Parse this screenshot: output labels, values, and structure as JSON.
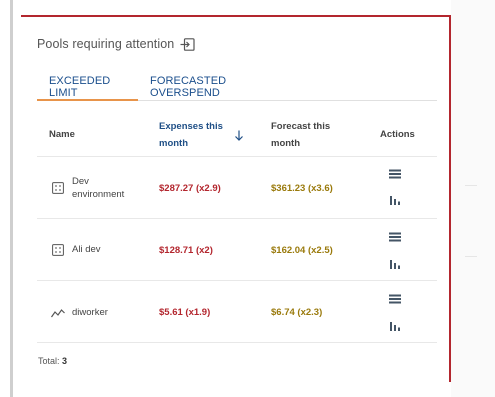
{
  "widget": {
    "title": "Pools requiring attention",
    "title_icon": "open-link-icon",
    "accent_color": "#b3262e",
    "tab_indicator_color": "#e8944a"
  },
  "tabs": [
    {
      "label": "EXCEEDED LIMIT",
      "active": true
    },
    {
      "label": "FORECASTED OVERSPEND",
      "active": false
    }
  ],
  "table": {
    "headers": {
      "name": "Name",
      "expenses_line1": "Expenses this",
      "expenses_line2": "month",
      "forecast_line1": "Forecast this",
      "forecast_line2": "month",
      "actions": "Actions"
    },
    "sort": {
      "column": "expenses",
      "direction": "descending",
      "icon": "arrow-down-icon"
    },
    "rows": [
      {
        "icon": "pool-grid-icon",
        "name_line1": "Dev",
        "name_line2": "environment",
        "expenses": "$287.27 (x2.9)",
        "forecast": "$361.23 (x3.6)"
      },
      {
        "icon": "pool-grid-icon",
        "name_line1": "Ali dev",
        "name_line2": "",
        "expenses": "$128.71 (x2)",
        "forecast": "$162.04 (x2.5)"
      },
      {
        "icon": "trend-line-icon",
        "name_line1": "diworker",
        "name_line2": "",
        "expenses": "$5.61 (x1.9)",
        "forecast": "$6.74 (x2.3)"
      }
    ],
    "action_icons": [
      "list-icon",
      "bar-chart-icon"
    ]
  },
  "footer": {
    "total_label": "Total:",
    "total_value": "3"
  },
  "colors": {
    "expense_text": "#b3262e",
    "forecast_text": "#9a7a0c",
    "link_blue": "#1a4e8c"
  }
}
